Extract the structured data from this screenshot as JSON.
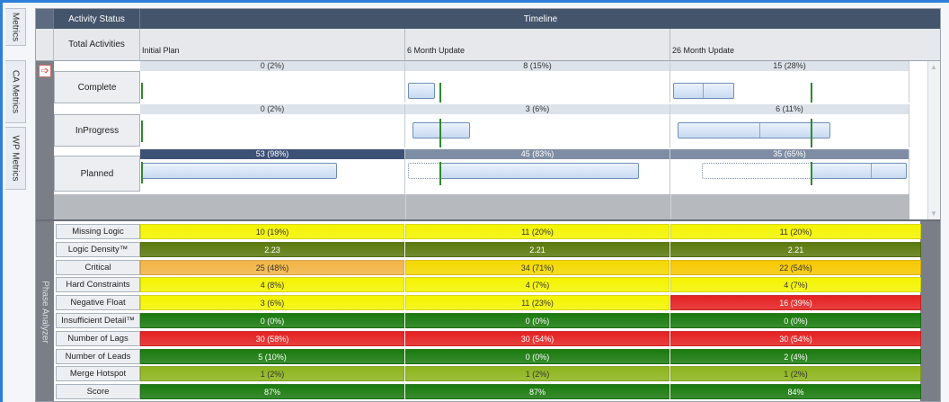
{
  "side_tabs": [
    "Metrics",
    "CA Metrics",
    "WP Metrics"
  ],
  "header": {
    "activity_status": "Activity Status",
    "timeline": "Timeline",
    "total_activities": "Total Activities",
    "columns": [
      "Initial  Plan",
      "6 Month Update",
      "26 Month Update"
    ]
  },
  "status_rows": [
    {
      "label": "Complete",
      "values": [
        "0 (2%)",
        "8 (15%)",
        "15 (28%)"
      ]
    },
    {
      "label": "InProgress",
      "values": [
        "0 (2%)",
        "3 (6%)",
        "6 (11%)"
      ]
    },
    {
      "label": "Planned",
      "values": [
        "53 (98%)",
        "45 (83%)",
        "35 (65%)"
      ]
    }
  ],
  "phase_analyzer_label": "Phase Analyzer",
  "metrics": [
    {
      "label": "Missing Logic",
      "values": [
        "10 (19%)",
        "11 (20%)",
        "11 (20%)"
      ],
      "colors": [
        "#f4f400",
        "#f4f400",
        "#f4f400"
      ],
      "text_colors": [
        "#333",
        "#333",
        "#333"
      ]
    },
    {
      "label": "Logic Density™",
      "values": [
        "2.23",
        "2.21",
        "2.21"
      ],
      "colors": [
        "#5b7a0e",
        "#5b7a0e",
        "#5b7a0e"
      ],
      "text_colors": [
        "#fff",
        "#fff",
        "#fff"
      ]
    },
    {
      "label": "Critical",
      "values": [
        "25 (48%)",
        "34 (71%)",
        "22 (54%)"
      ],
      "colors": [
        "#f2b445",
        "#f4d800",
        "#f7c800"
      ],
      "text_colors": [
        "#333",
        "#333",
        "#333"
      ]
    },
    {
      "label": "Hard Constraints",
      "values": [
        "4 (8%)",
        "4 (7%)",
        "4 (7%)"
      ],
      "colors": [
        "#f4f400",
        "#f4f400",
        "#f4f400"
      ],
      "text_colors": [
        "#333",
        "#333",
        "#333"
      ]
    },
    {
      "label": "Negative Float",
      "values": [
        "3 (6%)",
        "11 (23%)",
        "16 (39%)"
      ],
      "colors": [
        "#f4f400",
        "#f4f400",
        "#e52222"
      ],
      "text_colors": [
        "#333",
        "#333",
        "#fff"
      ]
    },
    {
      "label": "Insufficient Detail™",
      "values": [
        "0 (0%)",
        "0 (0%)",
        "0 (0%)"
      ],
      "colors": [
        "#1a7a0e",
        "#1a7a0e",
        "#1a7a0e"
      ],
      "text_colors": [
        "#fff",
        "#fff",
        "#fff"
      ]
    },
    {
      "label": "Number of Lags",
      "values": [
        "30 (58%)",
        "30 (54%)",
        "30 (54%)"
      ],
      "colors": [
        "#e52222",
        "#e52222",
        "#e52222"
      ],
      "text_colors": [
        "#fff",
        "#fff",
        "#fff"
      ]
    },
    {
      "label": "Number of Leads",
      "values": [
        "5 (10%)",
        "0 (0%)",
        "2 (4%)"
      ],
      "colors": [
        "#1a7a0e",
        "#1a7a0e",
        "#1a7a0e"
      ],
      "text_colors": [
        "#fff",
        "#fff",
        "#fff"
      ]
    },
    {
      "label": "Merge Hotspot",
      "values": [
        "1 (2%)",
        "1 (2%)",
        "1 (2%)"
      ],
      "colors": [
        "#8db41c",
        "#8db41c",
        "#8db41c"
      ],
      "text_colors": [
        "#333",
        "#333",
        "#333"
      ]
    },
    {
      "label": "Score",
      "values": [
        "87%",
        "87%",
        "84%"
      ],
      "colors": [
        "#1a7a0e",
        "#1a7a0e",
        "#1a7a0e"
      ],
      "text_colors": [
        "#fff",
        "#fff",
        "#fff"
      ]
    }
  ]
}
